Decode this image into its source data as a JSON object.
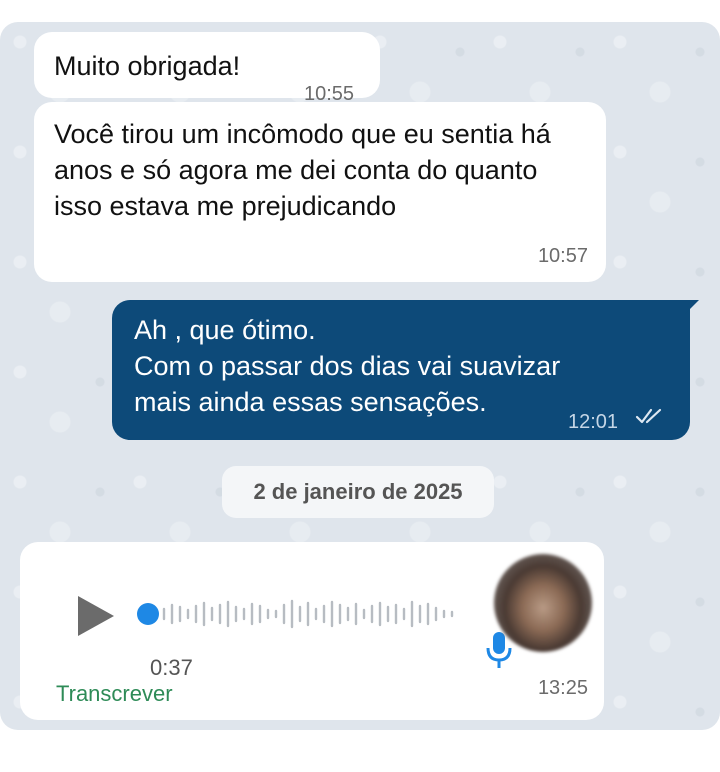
{
  "messages": {
    "m1": {
      "text": "Muito obrigada!",
      "time": "10:55"
    },
    "m2": {
      "text": "Você tirou um incômodo que eu sentia há anos e só agora me dei conta do quanto isso estava me prejudicando",
      "time": "10:57"
    },
    "m3": {
      "line1": "Ah , que ótimo.",
      "line2": "Com o passar dos dias vai suavizar",
      "line3": "mais ainda essas sensações.",
      "time": "12:01",
      "status_icon": "double-check-icon"
    }
  },
  "date_separator": "2 de janeiro de 2025",
  "voice_message": {
    "duration": "0:37",
    "transcribe_label": "Transcrever",
    "time": "13:25",
    "progress": 0
  },
  "colors": {
    "chat_background": "#dfe5ec",
    "incoming_bubble": "#ffffff",
    "outgoing_bubble": "#0d4a79",
    "accent": "#1e88e5",
    "transcribe": "#2e8b57"
  }
}
